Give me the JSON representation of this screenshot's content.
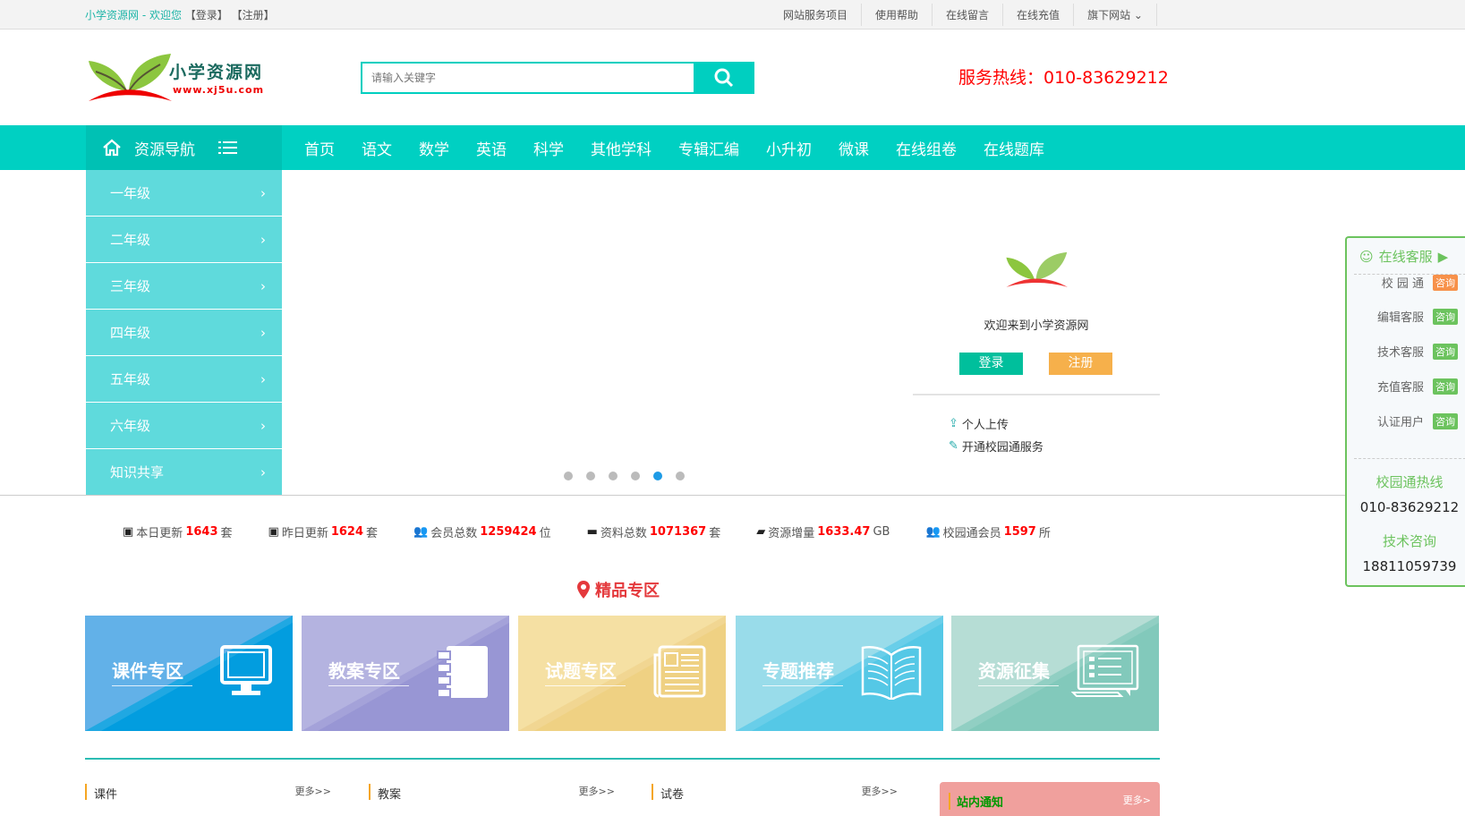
{
  "topbar": {
    "site": "小学资源网 - 欢迎您",
    "login": "【登录】",
    "register": "【注册】",
    "links": [
      "网站服务项目",
      "使用帮助",
      "在线留言",
      "在线充值",
      "旗下网站 ⌄"
    ]
  },
  "logo": {
    "name": "小学资源网",
    "url": "www.xj5u.com"
  },
  "search": {
    "placeholder": "请输入关键字"
  },
  "hotline": "服务热线：010-83629212",
  "nav": {
    "home": "资源导航",
    "links": [
      "首页",
      "语文",
      "数学",
      "英语",
      "科学",
      "其他学科",
      "专辑汇编",
      "小升初",
      "微课",
      "在线组卷",
      "在线题库"
    ]
  },
  "side": [
    "一年级",
    "二年级",
    "三年级",
    "四年级",
    "五年级",
    "六年级",
    "知识共享"
  ],
  "login": {
    "welcome": "欢迎来到小学资源网",
    "login": "登录",
    "register": "注册",
    "upload": "个人上传",
    "open": "开通校园通服务"
  },
  "carousel": {
    "count": 6,
    "active": 5
  },
  "kefu": {
    "title": "在线客服",
    "rows": [
      {
        "label": "校 园 通",
        "tag": "咨询"
      },
      {
        "label": "编辑客服",
        "tag": "咨询"
      },
      {
        "label": "技术客服",
        "tag": "咨询"
      },
      {
        "label": "充值客服",
        "tag": "咨询"
      },
      {
        "label": "认证用户",
        "tag": "咨询"
      }
    ],
    "hotline_label": "校园通热线",
    "hotline": "010-83629212",
    "tech_label": "技术咨询",
    "tech": "18811059739"
  },
  "stats": [
    {
      "label": "本日更新 ",
      "value": "1643",
      "unit": "套"
    },
    {
      "label": "昨日更新 ",
      "value": "1624",
      "unit": "套"
    },
    {
      "label": "会员总数 ",
      "value": "1259424",
      "unit": "位"
    },
    {
      "label": "资料总数 ",
      "value": "1071367",
      "unit": "套"
    },
    {
      "label": "资源增量 ",
      "value": "1633.47",
      "unit": "GB"
    },
    {
      "label": "校园通会员 ",
      "value": "1597",
      "unit": "所"
    }
  ],
  "featured": {
    "title": "精品专区",
    "cards": [
      {
        "label": "课件专区",
        "c1": "#62b1e8",
        "c2": "#029ddf"
      },
      {
        "label": "教案专区",
        "c1": "#b4b3e0",
        "c2": "#9896d4"
      },
      {
        "label": "试题专区",
        "c1": "#f5e0a3",
        "c2": "#efd183"
      },
      {
        "label": "专题推荐",
        "c1": "#99dcea",
        "c2": "#55c8e6"
      },
      {
        "label": "资源征集",
        "c1": "#b6ddd5",
        "c2": "#82c9bb"
      }
    ]
  },
  "columns": [
    {
      "title": "课件",
      "more": "更多>>"
    },
    {
      "title": "教案",
      "more": "更多>>"
    },
    {
      "title": "试卷",
      "more": "更多>>"
    }
  ],
  "notice": {
    "title": "站内通知",
    "more": "更多>"
  }
}
